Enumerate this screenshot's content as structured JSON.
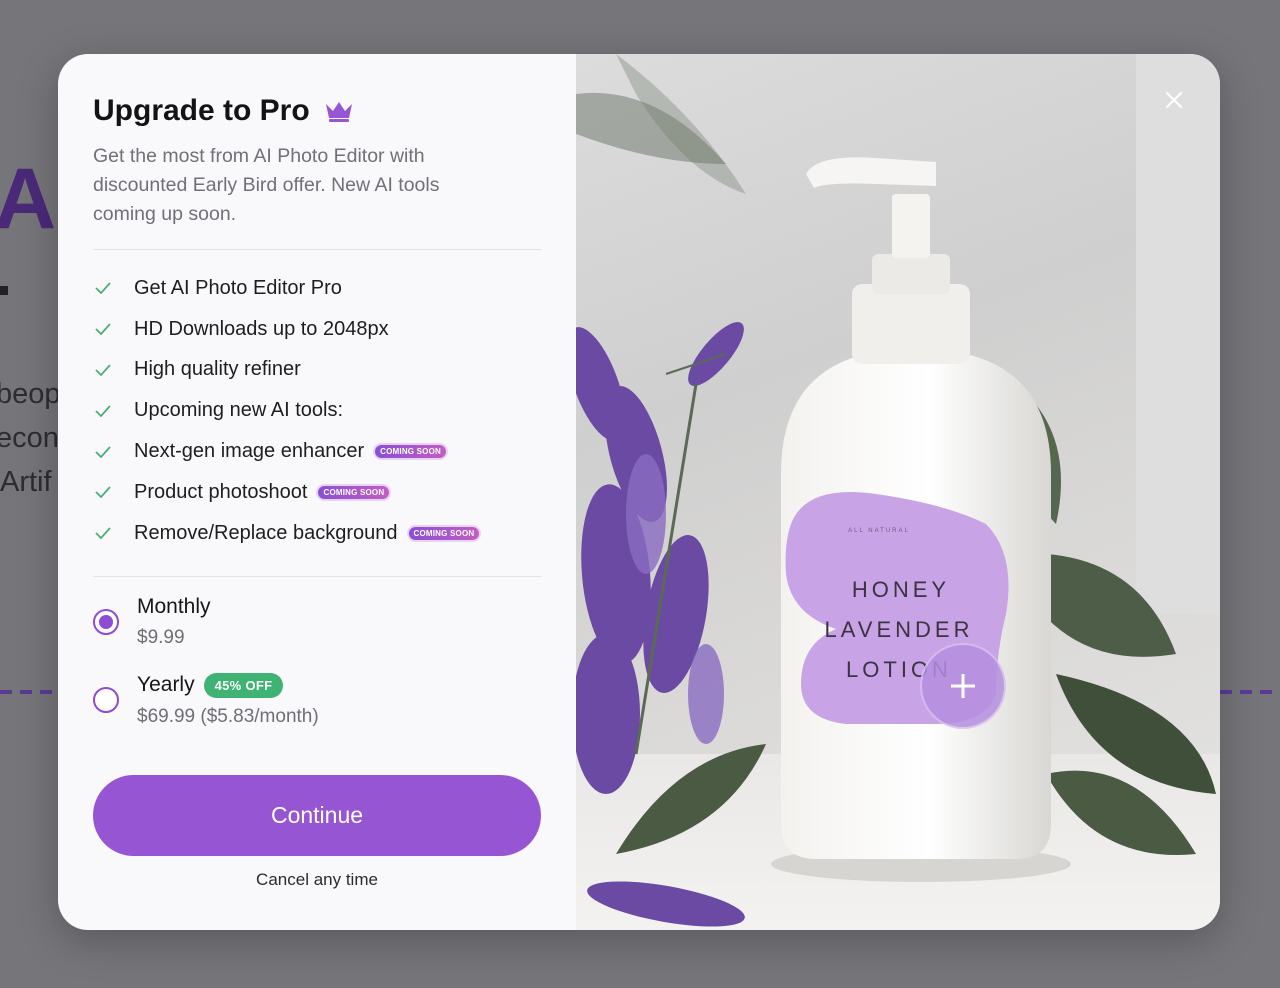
{
  "background": {
    "hero_fragment": "AI",
    "text_lines": [
      "beop",
      "econ",
      "Artif"
    ]
  },
  "modal": {
    "title": "Upgrade to Pro",
    "subtitle": "Get the most from AI Photo Editor with discounted Early Bird offer. New AI tools coming up soon.",
    "features": [
      {
        "label": "Get AI Photo Editor Pro",
        "badge": ""
      },
      {
        "label": "HD Downloads up to 2048px",
        "badge": ""
      },
      {
        "label": "High quality refiner",
        "badge": ""
      },
      {
        "label": "Upcoming new AI tools:",
        "badge": ""
      },
      {
        "label": "Next-gen image enhancer",
        "badge": "COMING SOON"
      },
      {
        "label": "Product photoshoot",
        "badge": "COMING SOON"
      },
      {
        "label": "Remove/Replace background",
        "badge": "COMING SOON"
      }
    ],
    "plans": [
      {
        "name": "Monthly",
        "price": "$9.99",
        "badge": "",
        "selected": true
      },
      {
        "name": "Yearly",
        "price": "$69.99 ($5.83/month)",
        "badge": "45% OFF",
        "selected": false
      }
    ],
    "continue_label": "Continue",
    "cancel_note": "Cancel any time",
    "close_icon": "close-icon",
    "crown_icon": "crown-icon",
    "check_icon": "check-icon"
  },
  "product_image": {
    "label_small": "ALL NATURAL",
    "label_line1": "HONEY",
    "label_line2": "LAVENDER",
    "label_line3": "LOTION"
  },
  "colors": {
    "accent": "#9656d4",
    "badge_green": "#3fb374",
    "check_green": "#4caf7a",
    "label_purple": "#c8a4e6"
  }
}
